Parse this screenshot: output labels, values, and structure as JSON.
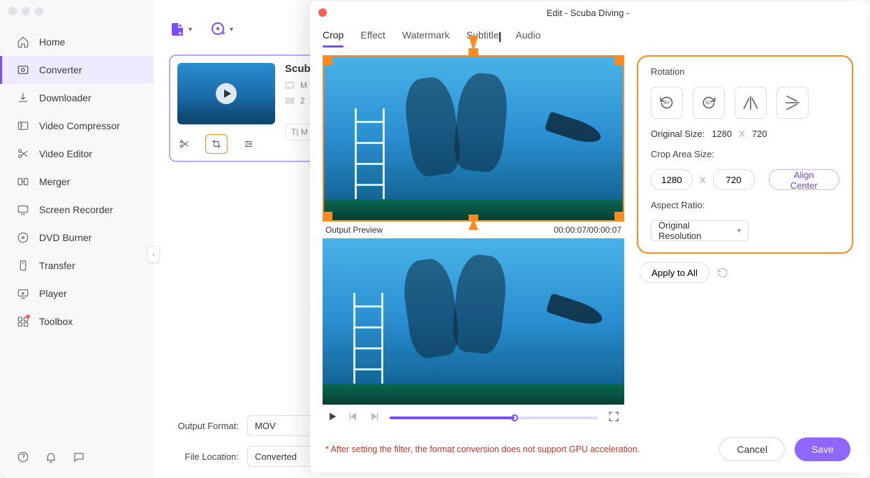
{
  "sidebar": {
    "items": [
      {
        "label": "Home"
      },
      {
        "label": "Converter"
      },
      {
        "label": "Downloader"
      },
      {
        "label": "Video Compressor"
      },
      {
        "label": "Video Editor"
      },
      {
        "label": "Merger"
      },
      {
        "label": "Screen Recorder"
      },
      {
        "label": "DVD Burner"
      },
      {
        "label": "Transfer"
      },
      {
        "label": "Player"
      },
      {
        "label": "Toolbox"
      }
    ]
  },
  "card": {
    "title": "Scub",
    "meta1": "M",
    "meta2": "2",
    "tag": "T|  M"
  },
  "bottom": {
    "format_label": "Output Format:",
    "format_value": "MOV",
    "location_label": "File Location:",
    "location_value": "Converted"
  },
  "modal": {
    "title": "Edit - Scuba Diving -",
    "tabs": [
      "Crop",
      "Effect",
      "Watermark",
      "Subtitle",
      "Audio"
    ],
    "preview_label": "Output Preview",
    "time": "00:00:07/00:00:07",
    "warn": "* After setting the filter, the format conversion does not support GPU acceleration.",
    "cancel": "Cancel",
    "save": "Save"
  },
  "panel": {
    "rotation": "Rotation",
    "orig_label": "Original Size:",
    "orig_w": "1280",
    "orig_h": "720",
    "x": "X",
    "crop_label": "Crop Area Size:",
    "crop_w": "1280",
    "crop_h": "720",
    "align": "Align Center",
    "aspect_label": "Aspect Ratio:",
    "aspect_value": "Original Resolution",
    "apply": "Apply to All"
  }
}
